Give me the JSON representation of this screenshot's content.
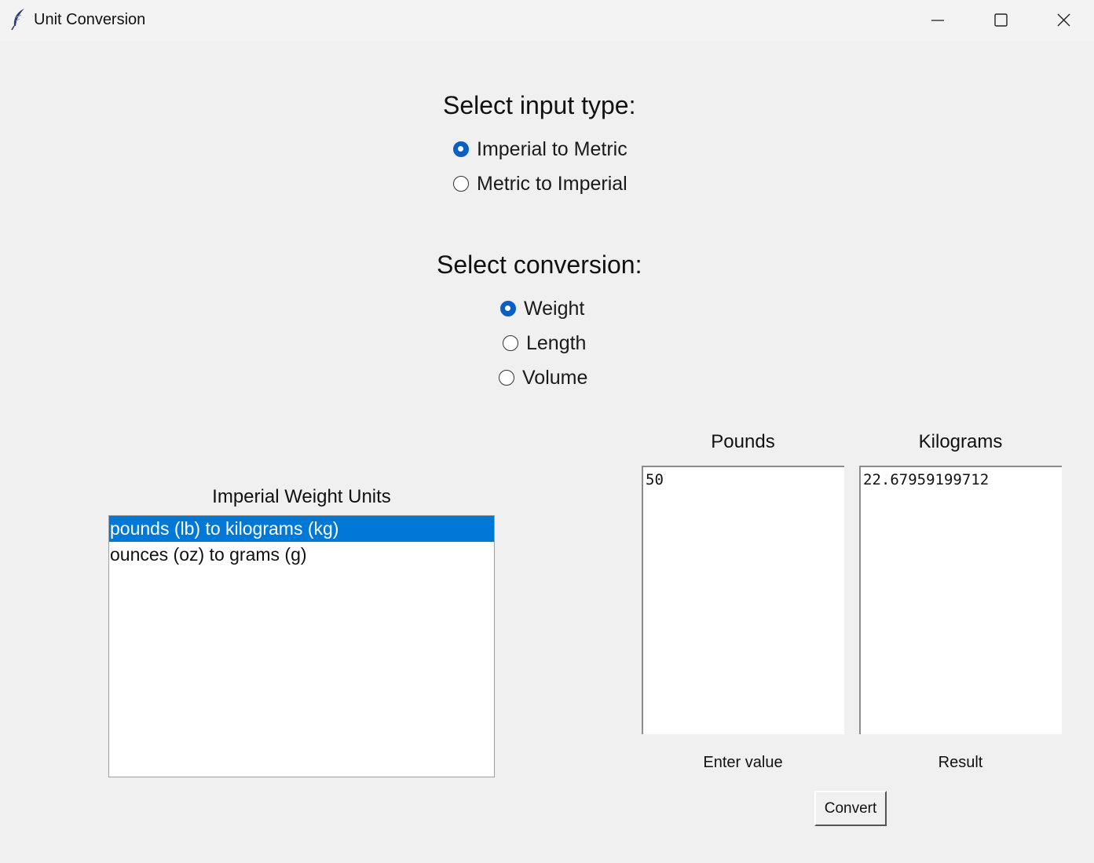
{
  "window": {
    "title": "Unit Conversion",
    "icon": "feather-icon",
    "controls": [
      "minimize-icon",
      "maximize-icon",
      "close-icon"
    ]
  },
  "input_type": {
    "heading": "Select input type:",
    "options": [
      {
        "label": "Imperial to Metric",
        "checked": true
      },
      {
        "label": "Metric to Imperial",
        "checked": false
      }
    ]
  },
  "conversion": {
    "heading": "Select conversion:",
    "options": [
      {
        "label": "Weight",
        "checked": true
      },
      {
        "label": "Length",
        "checked": false
      },
      {
        "label": "Volume",
        "checked": false
      }
    ]
  },
  "units_list": {
    "title": "Imperial Weight Units",
    "items": [
      {
        "label": "pounds (lb) to kilograms (kg)",
        "selected": true
      },
      {
        "label": "ounces (oz) to grams (g)",
        "selected": false
      }
    ]
  },
  "input_box": {
    "header": "Pounds",
    "value": "50",
    "caption": "Enter value"
  },
  "output_box": {
    "header": "Kilograms",
    "value": "22.67959199712",
    "caption": "Result"
  },
  "convert_button": {
    "label": "Convert"
  },
  "colors": {
    "background": "#f0f0f0",
    "accent": "#0078d7",
    "radio_checked": "#0a5fc4"
  }
}
